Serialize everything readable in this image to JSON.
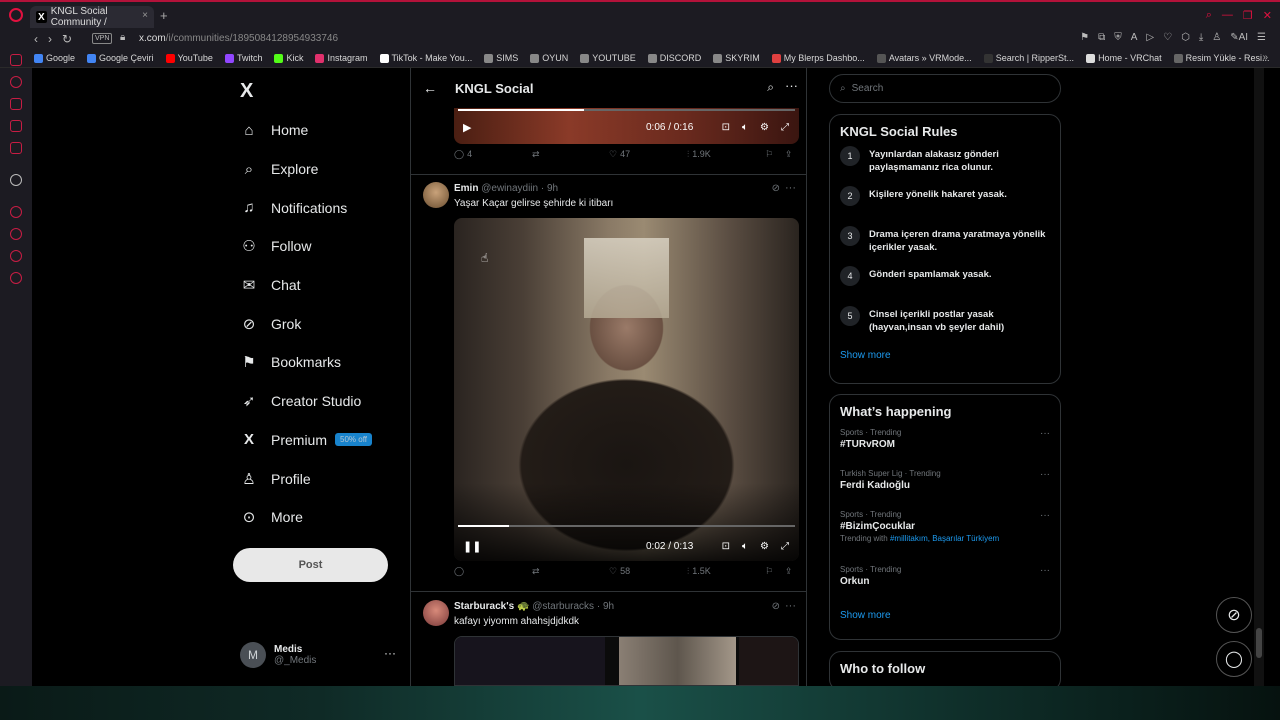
{
  "browser": {
    "tab_title": "KNGL Social Community /",
    "url_host": "x.com",
    "url_path": "/i/communities/1895084128954933746",
    "vpn_label": "VPN",
    "bookmarks": [
      {
        "label": "Google",
        "color": "#4285f4"
      },
      {
        "label": "Google Çeviri",
        "color": "#4285f4"
      },
      {
        "label": "YouTube",
        "color": "#ff0000"
      },
      {
        "label": "Twitch",
        "color": "#9146ff"
      },
      {
        "label": "Kick",
        "color": "#53fc18"
      },
      {
        "label": "Instagram",
        "color": "#e1306c"
      },
      {
        "label": "TikTok - Make You...",
        "color": "#ffffff"
      },
      {
        "label": "SIMS",
        "color": "#888888"
      },
      {
        "label": "OYUN",
        "color": "#888888"
      },
      {
        "label": "YOUTUBE",
        "color": "#888888"
      },
      {
        "label": "DISCORD",
        "color": "#888888"
      },
      {
        "label": "SKYRIM",
        "color": "#888888"
      },
      {
        "label": "My Blerps Dashbo...",
        "color": "#e04040"
      },
      {
        "label": "Avatars » VRMode...",
        "color": "#555555"
      },
      {
        "label": "Search | RipperSt...",
        "color": "#333333"
      },
      {
        "label": "Home - VRChat",
        "color": "#dddddd"
      },
      {
        "label": "Resim Yükle - Resi...",
        "color": "#666666"
      }
    ]
  },
  "nav": {
    "brand": "X",
    "items": [
      {
        "label": "Home",
        "icon": "home-icon",
        "glyph": "⌂"
      },
      {
        "label": "Explore",
        "icon": "search-icon",
        "glyph": "⌕"
      },
      {
        "label": "Notifications",
        "icon": "bell-icon",
        "glyph": "♫"
      },
      {
        "label": "Follow",
        "icon": "follow-icon",
        "glyph": "⚇"
      },
      {
        "label": "Chat",
        "icon": "mail-icon",
        "glyph": "✉"
      },
      {
        "label": "Grok",
        "icon": "grok-icon",
        "glyph": "⊘"
      },
      {
        "label": "Bookmarks",
        "icon": "bookmark-icon",
        "glyph": "⚑"
      },
      {
        "label": "Creator Studio",
        "icon": "rocket-icon",
        "glyph": "➶"
      },
      {
        "label": "Premium",
        "icon": "x-premium-icon",
        "glyph": "X",
        "badge": "50% off"
      },
      {
        "label": "Profile",
        "icon": "person-icon",
        "glyph": "♙"
      },
      {
        "label": "More",
        "icon": "more-circle-icon",
        "glyph": "⊙"
      }
    ],
    "post_label": "Post",
    "account": {
      "initial": "M",
      "name": "Medis",
      "handle": "@_Medis"
    }
  },
  "header": {
    "title": "KNGL Social"
  },
  "posts": [
    {
      "video_time": "0:06 / 0:16",
      "video_progress": 0.375,
      "replies": "4",
      "retweets": "",
      "likes": "47",
      "views": "1.9K"
    },
    {
      "name": "Emin",
      "handle": "@ewinaydiin",
      "time": "9h",
      "text": "Yaşar Kaçar gelirse şehirde ki itibarı",
      "video_time": "0:02 / 0:13",
      "video_progress": 0.15,
      "replies": "",
      "retweets": "",
      "likes": "58",
      "views": "1.5K"
    },
    {
      "name": "Starburack's 🐢",
      "handle": "@starburacks",
      "time": "9h",
      "text": "kafayı yiyomm ahahsjdjdkdk"
    }
  ],
  "right": {
    "search_placeholder": "Search",
    "rules_title": "KNGL Social Rules",
    "rules": [
      {
        "num": "1",
        "text": "Yayınlardan alakasız gönderi paylaşmamanız rica olunur."
      },
      {
        "num": "2",
        "text": "Kişilere yönelik hakaret yasak."
      },
      {
        "num": "3",
        "text": "Drama içeren drama yaratmaya yönelik içerikler yasak."
      },
      {
        "num": "4",
        "text": "Gönderi spamlamak yasak."
      },
      {
        "num": "5",
        "text": "Cinsel içerikli postlar yasak (hayvan,insan vb şeyler dahil)"
      }
    ],
    "show_more": "Show more",
    "happening_title": "What’s happening",
    "trends": [
      {
        "category": "Sports · Trending",
        "title": "#TURvROM",
        "with": ""
      },
      {
        "category": "Turkish Super Lig · Trending",
        "title": "Ferdi Kadıoğlu",
        "with": ""
      },
      {
        "category": "Sports · Trending",
        "title": "#BizimÇocuklar",
        "with_prefix": "Trending with",
        "with": "#millitakım, Başarılar Türkiyem"
      },
      {
        "category": "Sports · Trending",
        "title": "Orkun",
        "with": ""
      }
    ],
    "show_more_2": "Show more",
    "who_to_follow": "Who to follow"
  }
}
